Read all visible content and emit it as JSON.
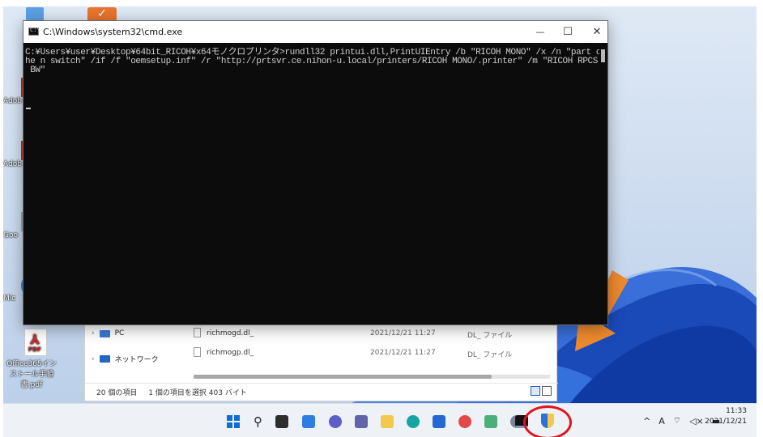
{
  "cmd": {
    "title": "C:\\Windows\\system32\\cmd.exe",
    "icon_label": "C:\\",
    "console_text": "C:¥Users¥user¥Desktop¥64bit_RICOH¥x64モノクロプリンタ>rundll32 printui.dll,PrintUIEntry /b \"RICOH MONO\" /x /n \"part of t\nhe n switch\" /if /f \"oemsetup.inf\" /r \"http://prtsvr.ce.nihon-u.local/printers/RICOH MONO/.printer\" /m \"RICOH RPCS Basic\n BW\"",
    "minimize": "—",
    "maximize": "☐",
    "close": "✕"
  },
  "desktop": {
    "icons": [
      {
        "label": "Adob",
        "kind": "red-app"
      },
      {
        "label": "Adob",
        "kind": "red-app"
      },
      {
        "label": "Goo",
        "kind": "gray-app"
      },
      {
        "label": "Mic",
        "kind": "blue-app"
      },
      {
        "label": "Office365インストール手順書.pdf",
        "kind": "pdf"
      }
    ],
    "pdf_tag": "PDF"
  },
  "explorer": {
    "nav": [
      {
        "label": "PC"
      },
      {
        "label": "ネットワーク"
      }
    ],
    "files": [
      {
        "name": "richmogd.dl_",
        "date": "2021/12/21 11:27",
        "type": "DL_ ファイル"
      },
      {
        "name": "richmogp.dl_",
        "date": "2021/12/21 11:27",
        "type": "DL_ ファイル"
      }
    ],
    "status": {
      "count": "20 個の項目",
      "selection": "1 個の項目を選択 403 バイト"
    }
  },
  "taskbar": {
    "tray_chevron": "^",
    "ime": "A",
    "time": "11:33",
    "date": "2021/12/21"
  },
  "colors": {
    "console_bg": "#0c0c0c",
    "console_fg": "#cccccc",
    "arrow": "#ee8a2d",
    "highlight": "#e0141e"
  }
}
